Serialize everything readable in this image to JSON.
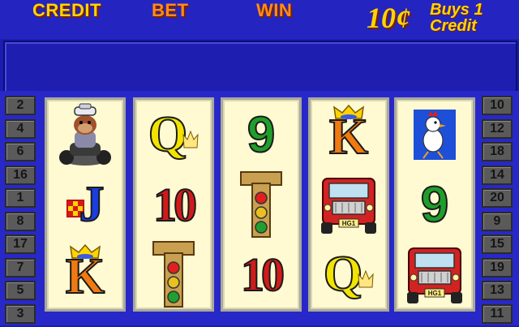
{
  "header": {
    "credit_label": "CREDIT",
    "bet_label": "BET",
    "win_label": "WIN",
    "denomination": "10¢",
    "buys_line1": "Buys 1",
    "buys_line2": "Credit"
  },
  "message": "",
  "lines_left": [
    "2",
    "4",
    "6",
    "16",
    "1",
    "8",
    "17",
    "7",
    "5",
    "3"
  ],
  "lines_right": [
    "10",
    "12",
    "18",
    "14",
    "20",
    "9",
    "15",
    "19",
    "13",
    "11"
  ],
  "reels": [
    [
      {
        "name": "biker-bulldog-icon"
      },
      {
        "name": "jack-symbol",
        "text": "J"
      },
      {
        "name": "king-symbol",
        "text": "K"
      }
    ],
    [
      {
        "name": "queen-symbol",
        "text": "Q"
      },
      {
        "name": "ten-symbol",
        "text": "10"
      },
      {
        "name": "traffic-light-icon"
      }
    ],
    [
      {
        "name": "nine-symbol",
        "text": "9"
      },
      {
        "name": "traffic-light-icon"
      },
      {
        "name": "ten-symbol",
        "text": "10"
      }
    ],
    [
      {
        "name": "king-symbol",
        "text": "K"
      },
      {
        "name": "truck-icon"
      },
      {
        "name": "queen-symbol",
        "text": "Q"
      }
    ],
    [
      {
        "name": "chicken-icon"
      },
      {
        "name": "nine-symbol",
        "text": "9"
      },
      {
        "name": "truck-icon"
      }
    ]
  ],
  "truck_plate": "HG1",
  "colors": {
    "background": "#1c1cb4",
    "label_yellow": "#ffd400",
    "label_orange": "#ff8c1a",
    "reel_bg": "#fffad2"
  }
}
